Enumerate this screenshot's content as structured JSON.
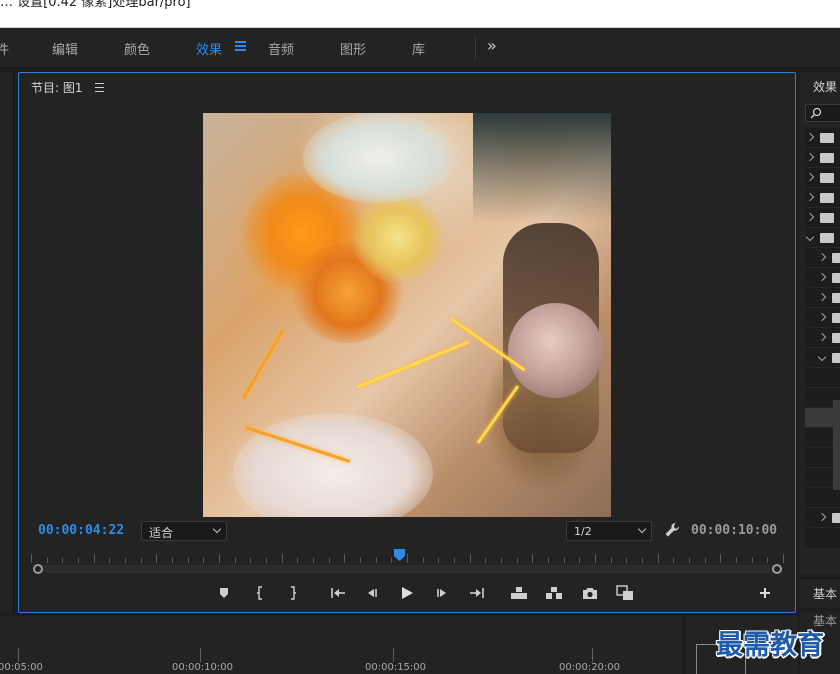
{
  "window": {
    "title": "… 设置[0.42 像素]处理bar/pro]"
  },
  "workspaces": {
    "items": [
      "件",
      "编辑",
      "颜色",
      "效果",
      "音频",
      "图形",
      "库"
    ],
    "active": "效果",
    "more_label": "»"
  },
  "program_monitor": {
    "title": "节目: 图1",
    "menu_icon": "hamburger-menu-icon",
    "current_timecode": "00:00:04:22",
    "zoom_select": "适合",
    "resolution_select": "1/2",
    "duration_timecode": "00:00:10:00",
    "playhead_progress": 0.49,
    "accent_color": "#2d8ceb",
    "transport_icons": [
      "add-marker-icon",
      "mark-in-icon",
      "mark-out-icon",
      "go-to-in-icon",
      "step-back-icon",
      "play-icon",
      "step-forward-icon",
      "go-to-out-icon",
      "lift-icon",
      "extract-icon",
      "export-frame-icon",
      "comparison-view-icon",
      "add-button-icon"
    ]
  },
  "effects_panel": {
    "title": "效果",
    "search_icon": "search-icon"
  },
  "essential": {
    "label1": "基本",
    "label2": "基本"
  },
  "timeline": {
    "ruler_labels": [
      "00:05:00",
      "00:00:10:00",
      "00:00:15:00",
      "00:00:20:00"
    ]
  },
  "watermark": {
    "text": "最需教育"
  }
}
